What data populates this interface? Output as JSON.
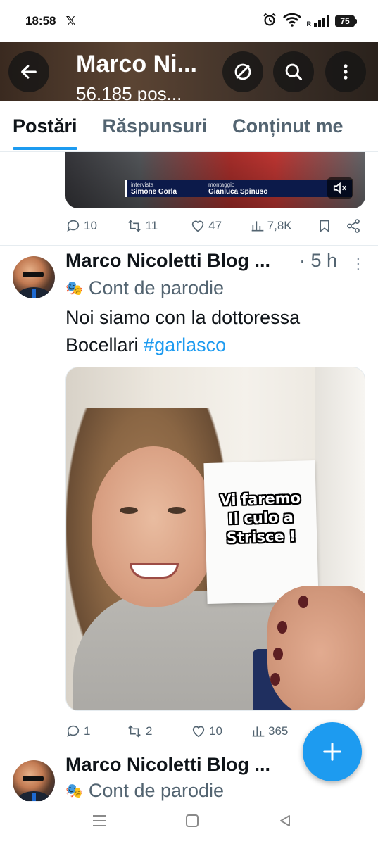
{
  "status_bar": {
    "time": "18:58",
    "x_logo": "𝕏",
    "battery": "75",
    "signal_label": "R"
  },
  "header": {
    "title": "Marco Ni...",
    "subtitle": "56.185 pos..."
  },
  "tabs": [
    {
      "label": "Postări",
      "active": true
    },
    {
      "label": "Răspunsuri",
      "active": false
    },
    {
      "label": "Conținut me",
      "active": false
    }
  ],
  "tweet_prev": {
    "media": {
      "credit_left_label": "intervista",
      "credit_left_name": "Simone Gorla",
      "credit_right_label": "montaggio",
      "credit_right_name": "Gianluca Spinuso"
    },
    "actions": {
      "replies": "10",
      "retweets": "11",
      "likes": "47",
      "views": "7,8K"
    }
  },
  "tweet_main": {
    "name": "Marco Nicoletti Blog ...",
    "time": "· 5 h",
    "parody_label": "Cont de parodie",
    "text_main": "Noi siamo con la dottoressa Bocellari ",
    "hashtag": "#garlasco",
    "card_text_line1": "Vi faremo",
    "card_text_line2": "Il culo a",
    "card_text_line3": "Strisce !",
    "actions": {
      "replies": "1",
      "retweets": "2",
      "likes": "10",
      "views": "365"
    }
  },
  "tweet_next": {
    "name": "Marco Nicoletti Blog ...",
    "parody_label": "Cont de parodie"
  },
  "colors": {
    "accent": "#1d9bf0",
    "text_primary": "#0f1419",
    "text_secondary": "#536471"
  }
}
